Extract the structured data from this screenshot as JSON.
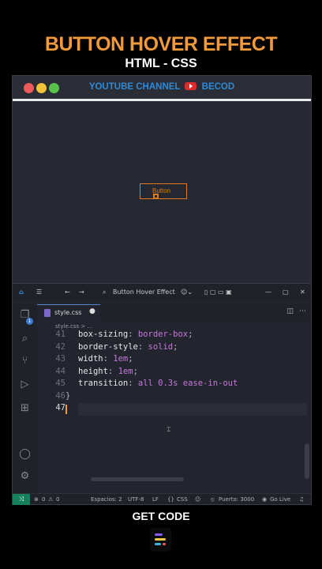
{
  "header": {
    "title": "BUTTON HOVER EFFECT",
    "subtitle": "HTML - CSS"
  },
  "browser": {
    "channel_prefix": "YOUTUBE CHANNEL",
    "channel_name": "BECOD"
  },
  "preview": {
    "button_label": "Button"
  },
  "vscode": {
    "search_text": "Button Hover Effect",
    "tab_label": "style.css",
    "breadcrumb": "style.css > ...",
    "badge": "1",
    "lines": [
      {
        "num": "41",
        "prop": "box-sizing",
        "value": "border-box"
      },
      {
        "num": "42",
        "prop": "border-style",
        "value": "solid"
      },
      {
        "num": "43",
        "prop": "width",
        "value": "1em"
      },
      {
        "num": "44",
        "prop": "height",
        "value": "1em"
      },
      {
        "num": "45",
        "prop": "transition",
        "value": "all 0.3s ease-in-out"
      },
      {
        "num": "46",
        "prop": "}",
        "value": ""
      },
      {
        "num": "47",
        "prop": "",
        "value": ""
      }
    ],
    "status": {
      "errors": "0",
      "warnings": "0",
      "spaces": "Espacios: 2",
      "encoding": "UTF-8",
      "eol": "LF",
      "language": "CSS",
      "port": "Puerto: 3000",
      "golive": "Go Live"
    }
  },
  "footer": {
    "cta": "GET CODE"
  },
  "colors": {
    "accent": "#f29a3a",
    "channel": "#2e8bd8",
    "youtube": "#e02b2b",
    "css_value": "#c678dd"
  }
}
